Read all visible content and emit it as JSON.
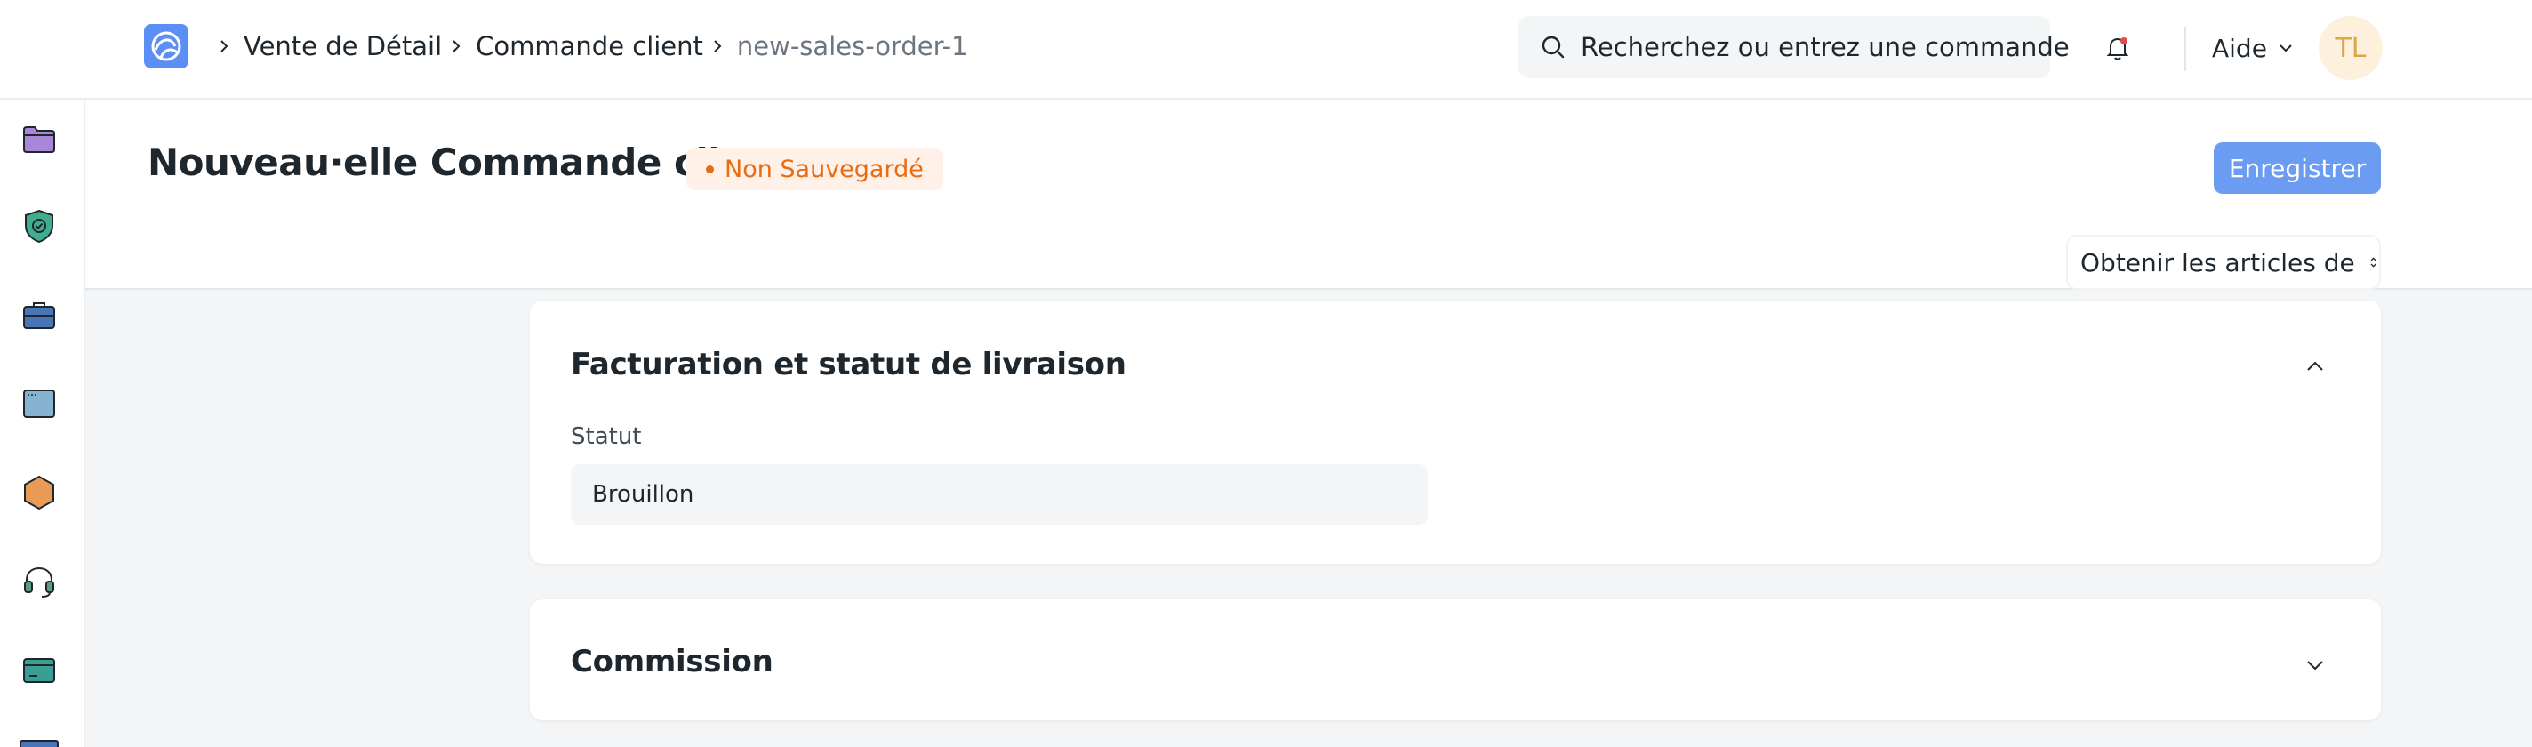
{
  "app": {
    "logo": "frappe-logo-icon",
    "accent_color": "#6b9cf2",
    "warning_color": "#e86c13"
  },
  "breadcrumb": {
    "items": [
      "Vente de Détail",
      "Commande client",
      "new-sales-order-1"
    ]
  },
  "search": {
    "placeholder": "Recherchez ou entrez une commande"
  },
  "navbar": {
    "help_label": "Aide",
    "avatar_initials": "TL"
  },
  "sidebar": {
    "icons": [
      "folder-icon",
      "shield-check-icon",
      "briefcase-icon",
      "window-icon",
      "hexagon-icon",
      "headset-icon",
      "card-icon"
    ]
  },
  "page": {
    "title": "Nouveau·elle Commande client",
    "status_badge": "Non Sauvegardé",
    "save_label": "Enregistrer",
    "get_items_label": "Obtenir les articles de"
  },
  "sections": {
    "billing": {
      "title": "Facturation et statut de livraison",
      "status_label": "Statut",
      "status_value": "Brouillon",
      "expanded": true
    },
    "commission": {
      "title": "Commission",
      "expanded": false
    }
  }
}
